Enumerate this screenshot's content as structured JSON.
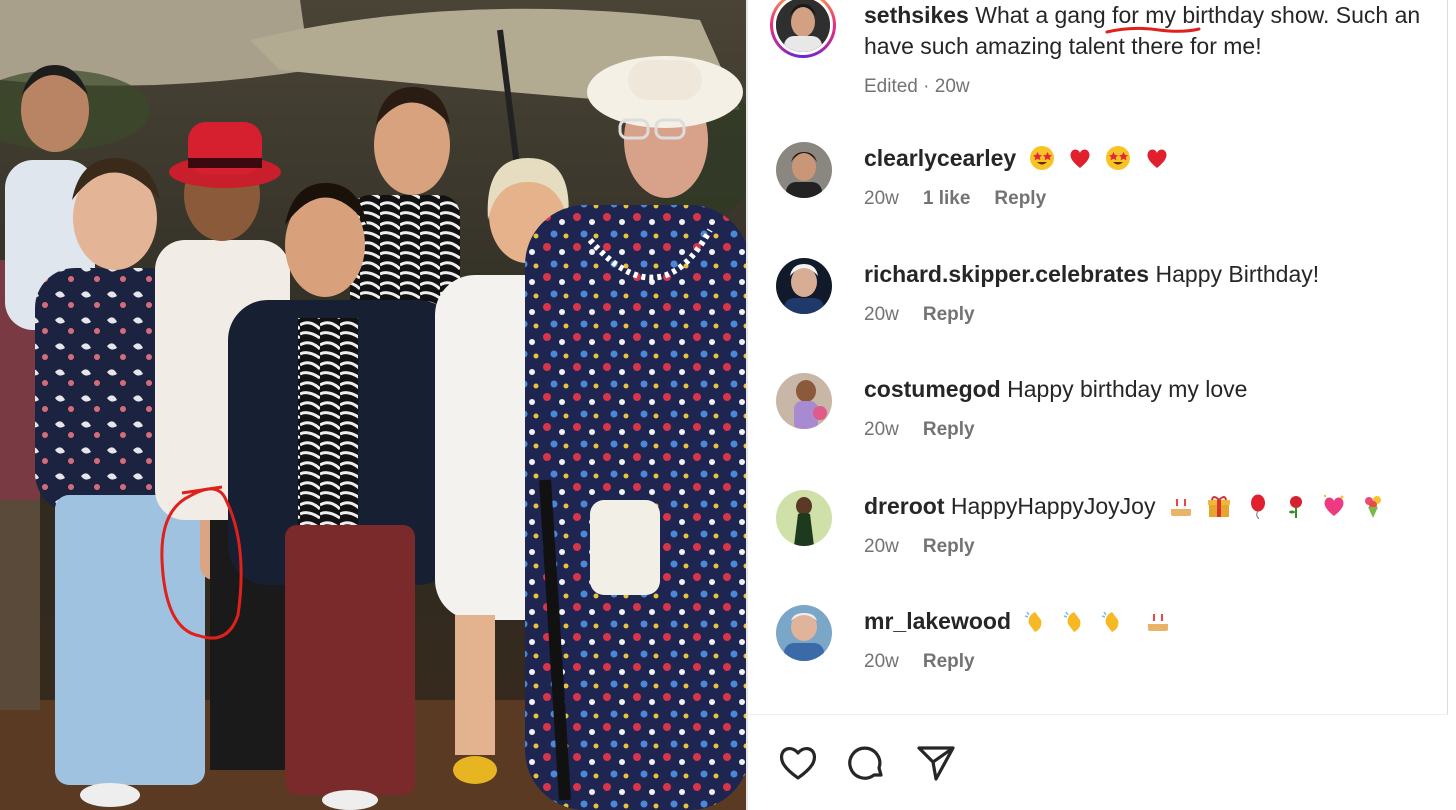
{
  "post": {
    "author": "sethsikes",
    "caption_line1": "What a gang for my birthday show. Such an",
    "caption_line2": "have such amazing talent there for me!",
    "edited_label": "Edited",
    "time": "20w"
  },
  "comments": [
    {
      "user": "clearlycearley",
      "text": "",
      "emojis": [
        "star-struck-emoji",
        "red-heart-emoji",
        "star-struck-emoji",
        "red-heart-emoji"
      ],
      "time": "20w",
      "likes": "1 like",
      "reply": "Reply"
    },
    {
      "user": "richard.skipper.celebrates",
      "text": "Happy Birthday!",
      "emojis": [],
      "time": "20w",
      "likes": "",
      "reply": "Reply"
    },
    {
      "user": "costumegod",
      "text": "Happy birthday my love",
      "emojis": [],
      "time": "20w",
      "likes": "",
      "reply": "Reply"
    },
    {
      "user": "dreroot",
      "text": "HappyHappyJoyJoy",
      "emojis": [
        "birthday-cake-emoji",
        "wrapped-gift-emoji",
        "balloon-emoji",
        "rose-emoji",
        "sparkling-heart-emoji",
        "bouquet-emoji"
      ],
      "time": "20w",
      "likes": "",
      "reply": "Reply"
    },
    {
      "user": "mr_lakewood",
      "text": "",
      "emojis": [
        "clapping-hands-emoji",
        "clapping-hands-emoji",
        "clapping-hands-emoji",
        "birthday-cake-emoji"
      ],
      "time": "20w",
      "likes": "",
      "reply": "Reply"
    }
  ],
  "actions": [
    "heart-icon",
    "comment-icon",
    "share-icon"
  ],
  "colors": {
    "text": "#262626",
    "muted": "#737373",
    "annotation_red": "#e0201b",
    "story_ring": [
      "#f9ce34",
      "#ee2a7b",
      "#6228d7"
    ]
  }
}
